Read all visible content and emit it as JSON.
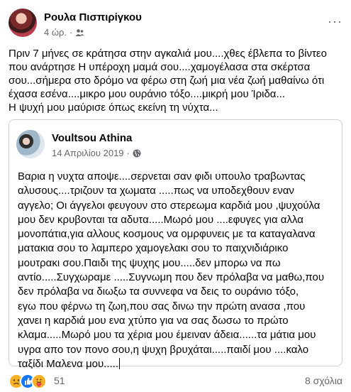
{
  "post": {
    "author": "Ρουλα Πισπιρίγκου",
    "time": "4 ώρ.",
    "separator": "·",
    "audience_icon": "friends-icon",
    "more_icon": "···",
    "text_lines": [
      "Πριν 7 μήνες σε κράτησα στην αγκαλιά μου....χθες έβλεπα το βίντεο",
      "που ανάρτησε Η υπέροχη μαμά σου....χαμογέλασα στα σκέρτσα",
      "σου...σήμερα στο δρόμο να φέρω στη ζωή μια νέα ζωή μαθαίνω ότι",
      "έχασα εσένα....μικρο μου ουράνιο τόξο....μικρή μου Ίριδα...",
      "Η ψυχή μου μαύρισε όπως εκείνη τη νύχτα..."
    ]
  },
  "shared": {
    "author": "Voultsou Athina",
    "date": "14 Απριλίου 2019",
    "separator": "·",
    "audience_icon": "globe-icon",
    "text_lines": [
      "Βαρια η νυχτα αποψε....σερνεται σαν φιδι υπουλο τραβωντας",
      "αλυσους....τριζουν τα χωματα .....πως να υποδεχθουν εναν",
      "αγγελο; Οι άγγελοι φευγουν στο στερεωμα καρδιά μου ,ψυχούλα",
      "μου δεν κρυβονται τα αδυτα.....Μωρό μου ....εφυγες για αλλα",
      "μονοπάτια,για αλλους κοσμους να ομρφυνεις με τα καταγαλανα",
      "ματακια σου το λαμπερο χαμογελακι σου το παιχνιδιάρικο",
      "μουτρακι σου.Παιδι της ψυχης μου.....δεν μπορω να πω",
      "αντίο.....Συγχωραμε .....Συγνωμη που δεν πρόλαβα να μαθω,που",
      "δεν πρόλαβα να διωξω τα συννεφα να δεις το ουράνιο τόξο,",
      "εγω που φέρνω τη ζωη,που σας δινω την πρώτη ανασα ,που",
      "χανει η καρδιά μου ενα χτύπο για να σας δωσω το πρώτο",
      "κλαμα.....Μωρό μου τα χέρια μου έμειναν άδεια......τα μάτια μου",
      "υγρα απο τον πονο σου,η ψυχη βρυχάται.....παιδί μου ....καλο",
      "ταξίδι Μαλενα μου....."
    ]
  },
  "reactions": {
    "icons": [
      "sad-icon",
      "like-icon",
      "care-icon"
    ],
    "count": "51"
  },
  "comments": {
    "label": "8 σχόλια"
  }
}
